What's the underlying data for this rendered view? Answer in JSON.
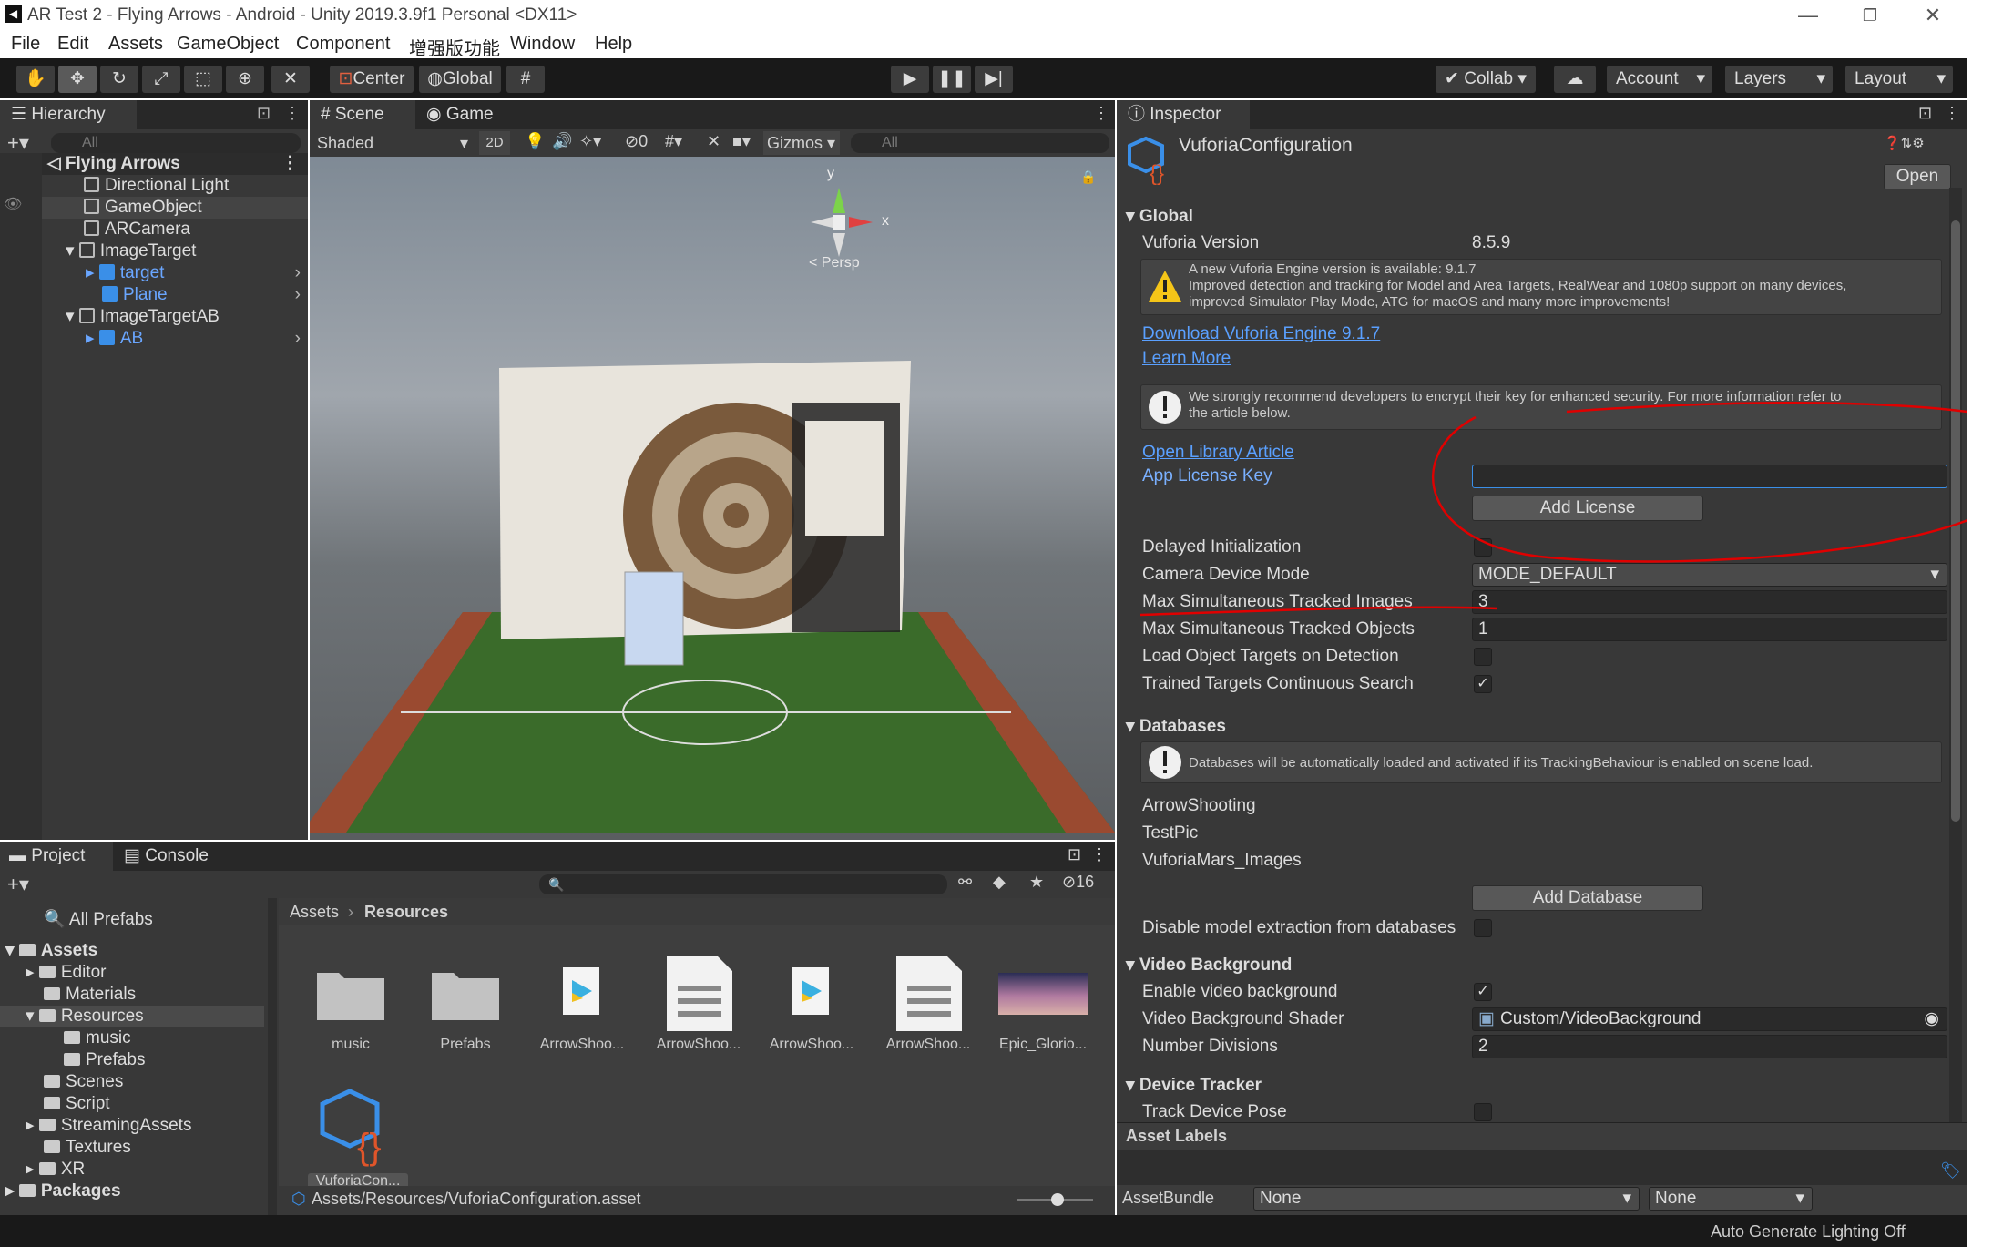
{
  "window": {
    "title": "AR Test 2 - Flying Arrows - Android - Unity 2019.3.9f1 Personal <DX11>"
  },
  "menu": [
    "File",
    "Edit",
    "Assets",
    "GameObject",
    "Component",
    "增强版功能",
    "Window",
    "Help"
  ],
  "toolbar": {
    "pivot": "Center",
    "space": "Global",
    "collab": "Collab",
    "account": "Account",
    "layers": "Layers",
    "layout": "Layout"
  },
  "hierarchy": {
    "tab": "Hierarchy",
    "search_placeholder": "All",
    "scene_name": "Flying Arrows",
    "items": [
      "Directional Light",
      "GameObject",
      "ARCamera",
      "ImageTarget",
      "target",
      "Plane",
      "ImageTargetAB",
      "AB"
    ]
  },
  "scene": {
    "tab_scene": "Scene",
    "tab_game": "Game",
    "shading": "Shaded",
    "mode2d": "2D",
    "hidden_count": "0",
    "gizmos": "Gizmos",
    "search_placeholder": "All",
    "persp": "< Persp",
    "axis_y": "y",
    "axis_x": "x"
  },
  "project": {
    "tab_project": "Project",
    "tab_console": "Console",
    "hidden_count": "16",
    "tree": [
      "All Prefabs",
      "Assets",
      "Editor",
      "Materials",
      "Resources",
      "music",
      "Prefabs",
      "Scenes",
      "Script",
      "StreamingAssets",
      "Textures",
      "XR",
      "Packages"
    ],
    "breadcrumb_root": "Assets",
    "breadcrumb_current": "Resources",
    "assets": [
      "music",
      "Prefabs",
      "ArrowShoo...",
      "ArrowShoo...",
      "ArrowShoo...",
      "ArrowShoo...",
      "Epic_Glorio...",
      "VuforiaCon..."
    ],
    "path": "Assets/Resources/VuforiaConfiguration.asset"
  },
  "inspector": {
    "tab": "Inspector",
    "object_name": "VuforiaConfiguration",
    "open_button": "Open",
    "global": {
      "header": "Global",
      "version_label": "Vuforia Version",
      "version_value": "8.5.9",
      "update_notice_1": "A new Vuforia Engine version is available: 9.1.7",
      "update_notice_2": "Improved detection and tracking for Model and Area Targets, RealWear and 1080p support on many devices,",
      "update_notice_3": "improved Simulator Play Mode, ATG for macOS and many more improvements!",
      "download_link": "Download Vuforia Engine 9.1.7",
      "learn_more": "Learn More",
      "security_1": "We strongly recommend developers to encrypt their key for enhanced security. For more information refer to",
      "security_2": "the article below.",
      "open_article": "Open Library Article",
      "license_key_label": "App License Key",
      "license_key_value": "",
      "add_license": "Add License",
      "delayed_init": "Delayed Initialization",
      "camera_mode_label": "Camera Device Mode",
      "camera_mode_value": "MODE_DEFAULT",
      "max_images_label": "Max Simultaneous Tracked Images",
      "max_images_value": "3",
      "max_objects_label": "Max Simultaneous Tracked Objects",
      "max_objects_value": "1",
      "load_object_targets": "Load Object Targets on Detection",
      "trained_targets": "Trained Targets Continuous Search"
    },
    "databases": {
      "header": "Databases",
      "notice": "Databases will be automatically loaded and activated if its TrackingBehaviour is enabled on scene load.",
      "items": [
        "ArrowShooting",
        "TestPic",
        "VuforiaMars_Images"
      ],
      "add_database": "Add Database",
      "disable_extraction": "Disable model extraction from databases"
    },
    "video": {
      "header": "Video Background",
      "enable_label": "Enable video background",
      "shader_label": "Video Background Shader",
      "shader_value": "Custom/VideoBackground",
      "divisions_label": "Number Divisions",
      "divisions_value": "2"
    },
    "device": {
      "header": "Device Tracker",
      "track_pose": "Track Device Pose"
    },
    "asset_labels": {
      "header": "Asset Labels",
      "bundle_label": "AssetBundle",
      "bundle_value": "None",
      "variant_value": "None"
    }
  },
  "status": {
    "lighting": "Auto Generate Lighting Off"
  },
  "colors": {
    "accent_blue": "#3a8fe8",
    "annotation_red": "#e00000",
    "panel_bg": "#383838"
  }
}
